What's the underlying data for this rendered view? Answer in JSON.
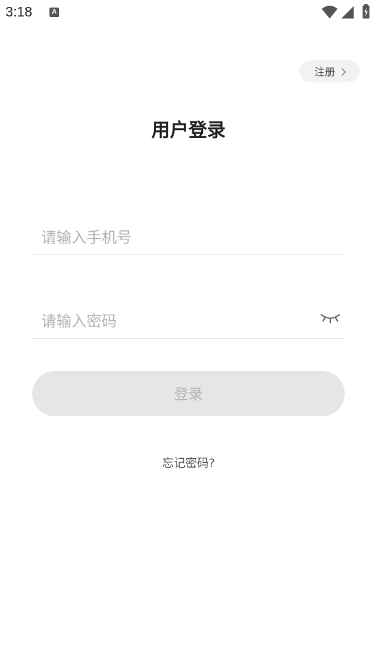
{
  "status_bar": {
    "time": "3:18",
    "notification_glyph": "A",
    "icons": [
      "wifi-icon",
      "signal-icon",
      "battery-charging-icon"
    ]
  },
  "header": {
    "register_label": "注册"
  },
  "page": {
    "title": "用户登录"
  },
  "form": {
    "phone_placeholder": "请输入手机号",
    "phone_value": "",
    "password_placeholder": "请输入密码",
    "password_value": "",
    "password_toggle_icon": "eye-closed-icon",
    "login_label": "登录",
    "forgot_label": "忘记密码?"
  },
  "colors": {
    "background": "#ffffff",
    "title": "#222222",
    "placeholder": "#b3b3b3",
    "button_disabled_bg": "#e6e6e6",
    "button_disabled_text": "#b5b5b5"
  }
}
